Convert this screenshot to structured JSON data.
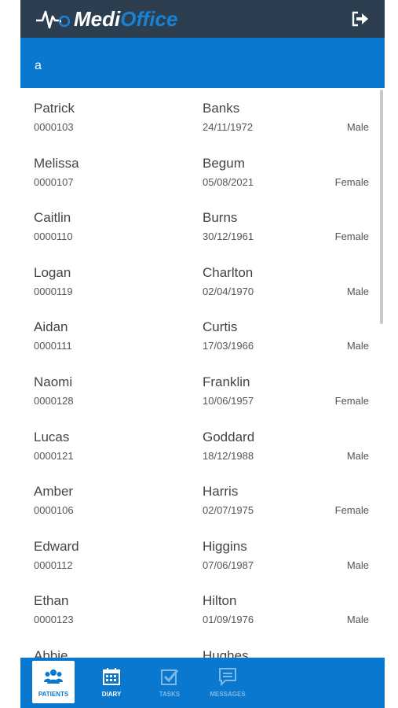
{
  "app": {
    "brand_part1": "Medi",
    "brand_part2": "Office",
    "header_color": "#2c3e50",
    "accent_color": "#0a78cf"
  },
  "search": {
    "value": "a"
  },
  "patients": [
    {
      "first": "Patrick",
      "last": "Banks",
      "id": "0000103",
      "dob": "24/11/1972",
      "sex": "Male"
    },
    {
      "first": "Melissa",
      "last": "Begum",
      "id": "0000107",
      "dob": "05/08/2021",
      "sex": "Female"
    },
    {
      "first": "Caitlin",
      "last": "Burns",
      "id": "0000110",
      "dob": "30/12/1961",
      "sex": "Female"
    },
    {
      "first": "Logan",
      "last": "Charlton",
      "id": "0000119",
      "dob": "02/04/1970",
      "sex": "Male"
    },
    {
      "first": "Aidan",
      "last": "Curtis",
      "id": "0000111",
      "dob": "17/03/1966",
      "sex": "Male"
    },
    {
      "first": "Naomi",
      "last": "Franklin",
      "id": "0000128",
      "dob": "10/06/1957",
      "sex": "Female"
    },
    {
      "first": "Lucas",
      "last": "Goddard",
      "id": "0000121",
      "dob": "18/12/1988",
      "sex": "Male"
    },
    {
      "first": "Amber",
      "last": "Harris",
      "id": "0000106",
      "dob": "02/07/1975",
      "sex": "Female"
    },
    {
      "first": "Edward",
      "last": "Higgins",
      "id": "0000112",
      "dob": "07/06/1987",
      "sex": "Male"
    },
    {
      "first": "Ethan",
      "last": "Hilton",
      "id": "0000123",
      "dob": "01/09/1976",
      "sex": "Male"
    },
    {
      "first": "Abbie",
      "last": "Hughes",
      "id": "",
      "dob": "",
      "sex": ""
    }
  ],
  "nav": {
    "patients": {
      "label": "PATIENTS",
      "icon": "users-icon"
    },
    "diary": {
      "label": "DIARY",
      "icon": "calendar-icon"
    },
    "tasks": {
      "label": "TASKS",
      "icon": "checkbox-icon"
    },
    "messages": {
      "label": "MESSAGES",
      "icon": "message-icon"
    }
  }
}
